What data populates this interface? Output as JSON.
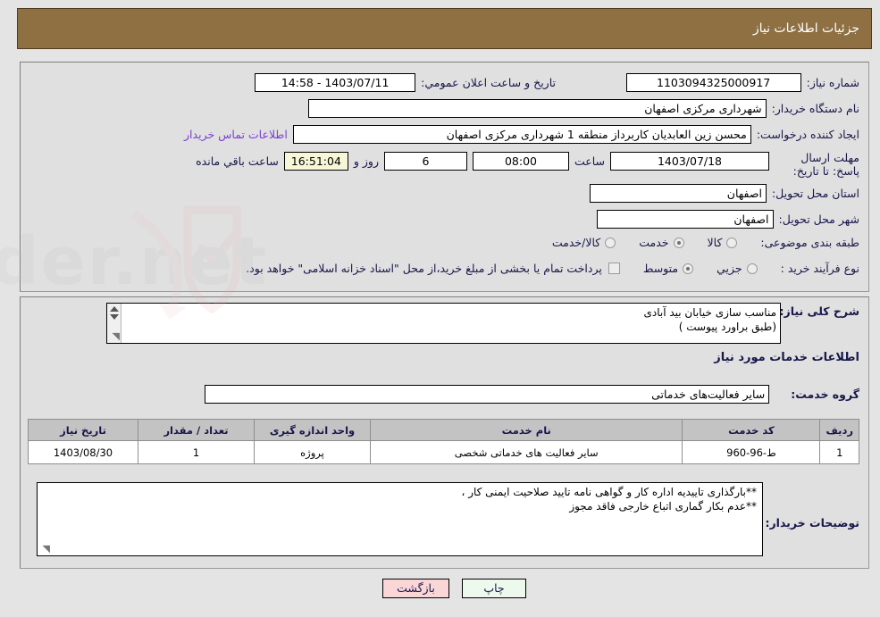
{
  "header": {
    "title": "جزئیات اطلاعات نیاز"
  },
  "colors": {
    "header_bar": "#8e7043",
    "panel_bg": "#e0e0e0",
    "page_bg": "#e4e4e4",
    "label_text": "#17174a",
    "link_text": "#7a3fd6",
    "table_header": "#c3c3c3",
    "countdown_field": "#f7f7d8",
    "print_button": "#edf9ed",
    "back_button": "#fbd6d6"
  },
  "form": {
    "need_number_label": "شماره نیاز:",
    "need_number_value": "1103094325000917",
    "announce_datetime_label": "تاریخ و ساعت اعلان عمومي:",
    "announce_datetime_value": "1403/07/11 - 14:58",
    "buyer_org_label": "نام دستگاه خریدار:",
    "buyer_org_value": "شهرداری مرکزی اصفهان",
    "requester_label": "ایجاد کننده درخواست:",
    "requester_value": "محسن زین العابدیان کاربرداز منطقه 1 شهرداری مرکزی اصفهان",
    "buyer_contact_link": "اطلاعات تماس خریدار",
    "deadline_label": "مهلت ارسال پاسخ: تا تاریخ:",
    "deadline_date": "1403/07/18",
    "deadline_time_label": "ساعت",
    "deadline_time": "08:00",
    "remaining_days": "6",
    "remaining_days_suffix": "روز و",
    "remaining_clock": "16:51:04",
    "remaining_suffix": "ساعت باقي مانده",
    "province_label": "استان محل تحویل:",
    "province_value": "اصفهان",
    "city_label": "شهر محل تحویل:",
    "city_value": "اصفهان",
    "category_label": "طبقه بندی موضوعی:",
    "category_options": [
      {
        "label": "کالا",
        "selected": false
      },
      {
        "label": "خدمت",
        "selected": true
      },
      {
        "label": "کالا/خدمت",
        "selected": false
      }
    ],
    "process_label": "نوع فرآیند خرید :",
    "process_options": [
      {
        "label": "جزیي",
        "selected": false
      },
      {
        "label": "متوسط",
        "selected": true
      }
    ],
    "treasury_checkbox_checked": false,
    "treasury_note": "پرداخت تمام یا بخشی از مبلغ خرید،از محل \"اسناد خزانه اسلامی\" خواهد بود."
  },
  "description": {
    "label": "شرح کلی نیاز:",
    "value": "مناسب سازی خیابان بید آبادی\n(طبق براورد پیوست )"
  },
  "services_section": {
    "heading": "اطلاعات خدمات مورد نیاز",
    "group_label": "گروه خدمت:",
    "group_value": "سایر فعالیت‌های خدماتی"
  },
  "table": {
    "headers": [
      "ردیف",
      "کد خدمت",
      "نام خدمت",
      "واحد اندازه گیری",
      "تعداد / مقدار",
      "تاریخ نیاز"
    ],
    "rows": [
      {
        "row": "1",
        "service_code": "ط-96-960",
        "service_name": "سایر فعالیت های خدماتی شخصی",
        "unit": "پروژه",
        "quantity": "1",
        "need_date": "1403/08/30"
      }
    ]
  },
  "buyer_notes": {
    "label": "توضیحات خریدار:",
    "value": "**بارگذاری  تاییدیه اداره کار و گواهی نامه تایید صلاحیت ایمنی کار ،\n**عدم بکار گماری اتباع خارجی فاقد مجوز"
  },
  "footer": {
    "print_label": "چاپ",
    "back_label": "بازگشت"
  },
  "watermark": {
    "text": "AriaTender.net"
  }
}
